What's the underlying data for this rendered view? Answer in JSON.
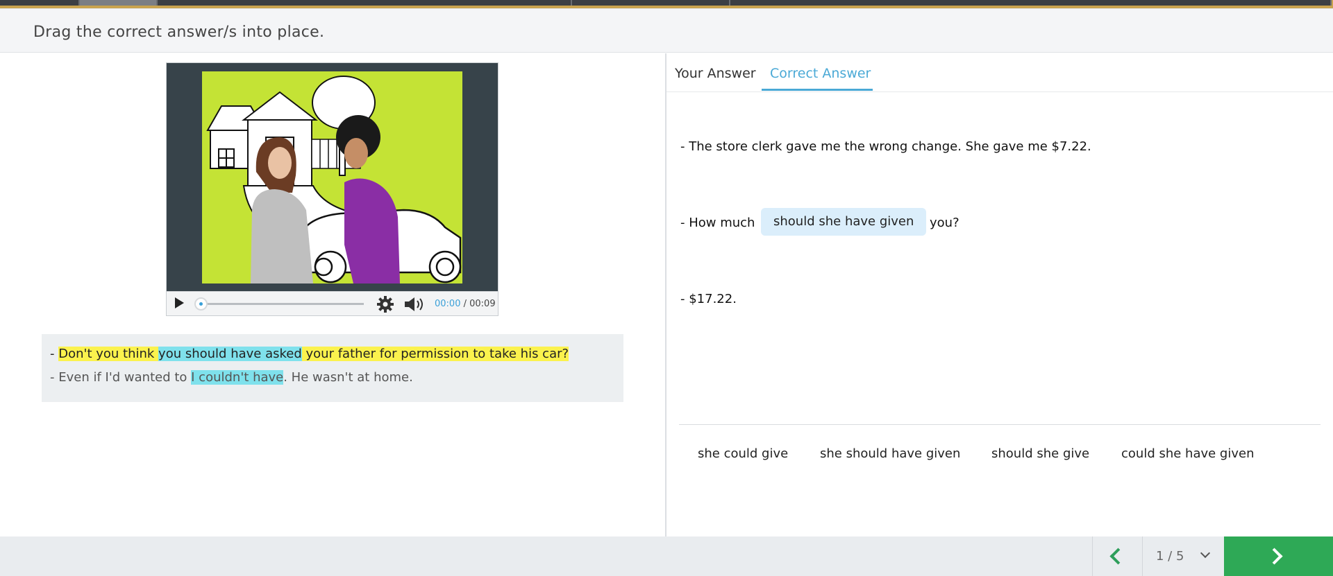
{
  "instruction": "Drag the correct answer/s into place.",
  "video": {
    "current_time": "00:00",
    "separator": " / ",
    "duration": "00:09"
  },
  "transcript": {
    "line1": {
      "prefix": "- ",
      "part1": "Don't you think ",
      "highlight": "you should have asked",
      "part2": " your father for permission to take his car?"
    },
    "line2": {
      "part1": "- Even if I'd wanted to ",
      "highlight": "I couldn't have",
      "part2": ". He wasn't at home."
    }
  },
  "tabs": [
    {
      "label": "Your Answer",
      "active": false
    },
    {
      "label": "Correct Answer",
      "active": true
    }
  ],
  "question": {
    "line1": "- The store clerk gave me the wrong change. She gave me $7.22.",
    "line2_start": "- How much",
    "answer": "should she have given",
    "line2_end": "you?",
    "line3": "- $17.22."
  },
  "options": [
    "she could give",
    "she should have given",
    "should she give",
    "could she have given"
  ],
  "pagination": {
    "label": "1 / 5"
  },
  "colors": {
    "accent_blue": "#4aa9d6",
    "highlight_yellow": "#fbf24d",
    "highlight_cyan": "#7fe1ec",
    "answer_chip": "#dbeefb",
    "next_green": "#2ea956"
  }
}
